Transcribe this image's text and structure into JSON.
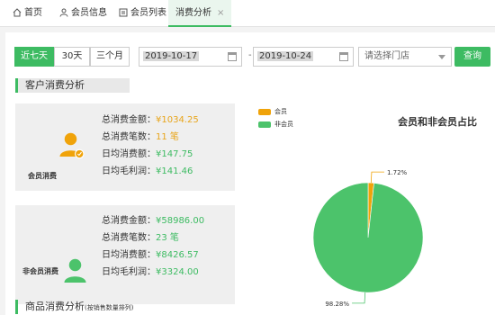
{
  "tabs": [
    {
      "label": "首页"
    },
    {
      "label": "会员信息"
    },
    {
      "label": "会员列表"
    },
    {
      "label": "消费分析",
      "close": "×"
    }
  ],
  "filters": {
    "ranges": [
      "近七天",
      "30天",
      "三个月"
    ],
    "start_date": "2019-10-17",
    "end_date": "2019-10-24",
    "date_sep": "-",
    "store_placeholder": "请选择门店",
    "query_label": "查询"
  },
  "section1_title": "客户消费分析",
  "member": {
    "label": "会员消费",
    "rows": [
      {
        "key": "总消费金额：",
        "value": "¥1034.25"
      },
      {
        "key": "总消费笔数：",
        "value": "11 笔"
      },
      {
        "key": "日均消费额：",
        "value": "¥147.75"
      },
      {
        "key": "日均毛利润：",
        "value": "¥141.46"
      }
    ]
  },
  "nonmember": {
    "label": "非会员消费",
    "rows": [
      {
        "key": "总消费金额：",
        "value": "¥58986.00"
      },
      {
        "key": "总消费笔数：",
        "value": "23 笔"
      },
      {
        "key": "日均消费额：",
        "value": "¥8426.57"
      },
      {
        "key": "日均毛利润：",
        "value": "¥3324.00"
      }
    ]
  },
  "colors": {
    "accent": "#3dbb62",
    "orange": "#f0a30a",
    "green": "#4cc36b"
  },
  "chart_data": {
    "type": "pie",
    "title": "会员和非会员占比",
    "series": [
      {
        "name": "会员",
        "value": 1.72,
        "label": "1.72%",
        "color": "#f0a30a"
      },
      {
        "name": "非会员",
        "value": 98.28,
        "label": "98.28%",
        "color": "#4cc36b"
      }
    ]
  },
  "section2_title": "商品消费分析",
  "section2_sub": "(按销售数量排列)"
}
